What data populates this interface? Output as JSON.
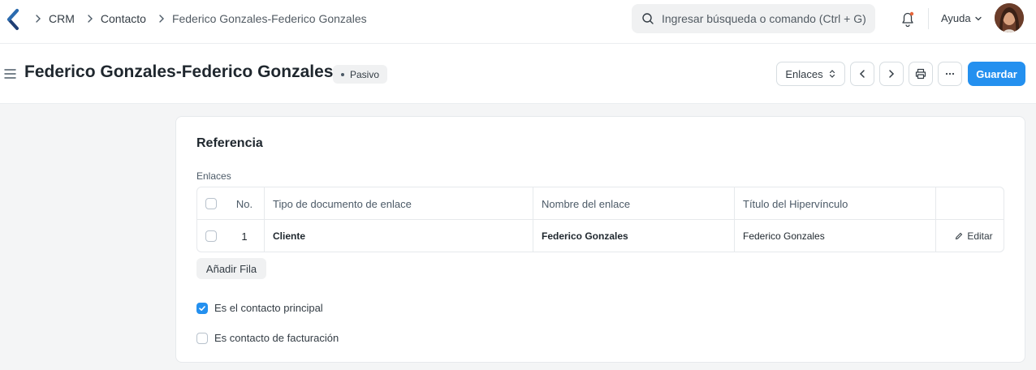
{
  "nav": {
    "breadcrumbs": [
      "CRM",
      "Contacto",
      "Federico Gonzales-Federico Gonzales"
    ],
    "search_placeholder": "Ingresar búsqueda o comando (Ctrl + G)",
    "help_label": "Ayuda",
    "icons": [
      "app-logo-icon",
      "chevron-right-icon",
      "search-icon",
      "bell-icon",
      "chevron-down-icon",
      "avatar"
    ]
  },
  "page": {
    "title": "Federico Gonzales-Federico Gonzales",
    "status": "Pasivo",
    "links_button": "Enlaces",
    "save_button": "Guardar",
    "icons": [
      "menu-icon",
      "sort-icon",
      "chevron-left-icon",
      "chevron-right-icon",
      "printer-icon",
      "more-icon"
    ]
  },
  "form": {
    "section_title": "Referencia",
    "links_label": "Enlaces",
    "table": {
      "columns": [
        "No.",
        "Tipo de documento de enlace",
        "Nombre del enlace",
        "Título del Hipervínculo"
      ],
      "rows": [
        {
          "no": "1",
          "link_doctype": "Cliente",
          "link_name": "Federico Gonzales",
          "link_title": "Federico Gonzales",
          "edit_label": "Editar"
        }
      ]
    },
    "add_row_label": "Añadir Fila",
    "is_primary_contact": {
      "label": "Es el contacto principal",
      "checked": true
    },
    "is_billing_contact": {
      "label": "Es contacto de facturación",
      "checked": false
    }
  },
  "colors": {
    "primary": "#2490ef",
    "logo": "#1f3e74",
    "text": "#1f272e"
  }
}
